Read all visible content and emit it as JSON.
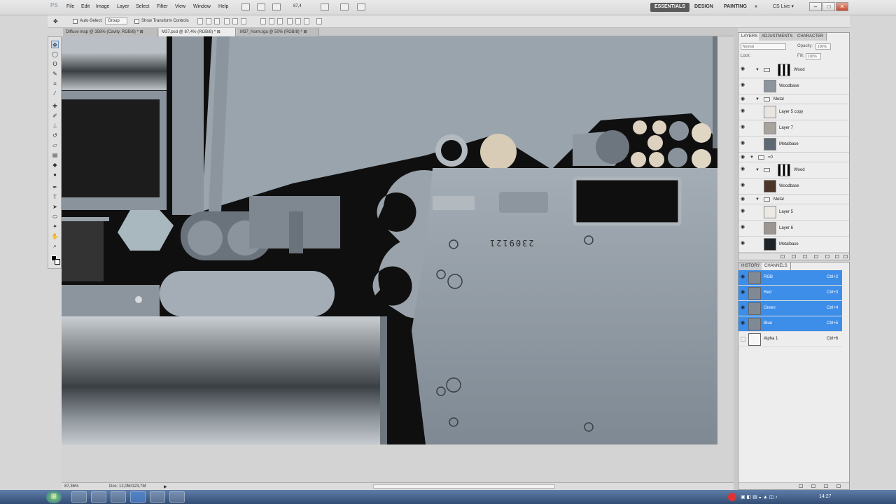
{
  "app": {
    "logo": "PS"
  },
  "menu": {
    "items": [
      "File",
      "Edit",
      "Image",
      "Layer",
      "Select",
      "Filter",
      "View",
      "Window",
      "Help"
    ]
  },
  "zoom_value": "87,4",
  "workspaces": [
    "ESSENTIALS",
    "DESIGN",
    "PAINTING"
  ],
  "more_label": "»",
  "cs_live": "CS Live ▾",
  "window_controls": {
    "minimize": "–",
    "maximize": "□",
    "close": "✕"
  },
  "options": {
    "auto_select": "Auto-Select:",
    "group_value": "Group",
    "show_transform": "Show Transform Controls"
  },
  "tabs": [
    {
      "label": "Diffuse map @ 358% (Cavity, RGB/8) *",
      "close": "⊠"
    },
    {
      "label": "M37.psd @ 87,4% (RGB/8) *",
      "close": "⊠"
    },
    {
      "label": "M37_Norm.tga @ 50% (RGB/8) *",
      "close": "⊠"
    }
  ],
  "canvas": {
    "serial": "2309121"
  },
  "status": {
    "zoom": "87,36%",
    "doc": "Doc: 12,0M/123,7M",
    "arrow": "▶"
  },
  "layers_panel": {
    "tabs": [
      "LAYERS",
      "ADJUSTMENTS",
      "CHARACTER"
    ],
    "blend_mode": "Normal",
    "opacity_label": "Opacity:",
    "opacity_value": "100%",
    "lock_label": "Lock:",
    "fill_label": "Fill:",
    "fill_value": "100%",
    "rows": [
      {
        "name": "Wood",
        "kind": "mask"
      },
      {
        "name": "Woodbase",
        "kind": "layer",
        "color": "#8c959e"
      },
      {
        "name": "Metal",
        "kind": "group"
      },
      {
        "name": "Layer 5 copy",
        "kind": "layer",
        "color": "#e9e6e2"
      },
      {
        "name": "Layer 7",
        "kind": "layer",
        "color": "#a9a39d"
      },
      {
        "name": "Metalbase",
        "kind": "layer",
        "color": "#5d6872"
      },
      {
        "name": "=0",
        "kind": "group"
      },
      {
        "name": "Wood",
        "kind": "mask"
      },
      {
        "name": "Woodbase",
        "kind": "layer",
        "color": "#4a3528"
      },
      {
        "name": "Metal",
        "kind": "group"
      },
      {
        "name": "Layer 5",
        "kind": "layer",
        "color": "#ece9e5"
      },
      {
        "name": "Layer 6",
        "kind": "layer",
        "color": "#9c9692"
      },
      {
        "name": "Metalbase",
        "kind": "layer",
        "color": "#1e2327"
      }
    ]
  },
  "channels_panel": {
    "tabs": [
      "HISTORY",
      "CHANNELS"
    ],
    "rows": [
      {
        "name": "RGB",
        "shortcut": "Ctrl+2",
        "selected": true
      },
      {
        "name": "Red",
        "shortcut": "Ctrl+3",
        "selected": true
      },
      {
        "name": "Green",
        "shortcut": "Ctrl+4",
        "selected": true
      },
      {
        "name": "Blue",
        "shortcut": "Ctrl+5",
        "selected": true
      },
      {
        "name": "Alpha 1",
        "shortcut": "Ctrl+6",
        "selected": false
      }
    ]
  },
  "taskbar": {
    "start": "⊞",
    "clock": "14:27"
  },
  "colors": {
    "accent": "#3c8ee9",
    "canvas_bg": "#101010",
    "metal": "#8e98a1"
  }
}
